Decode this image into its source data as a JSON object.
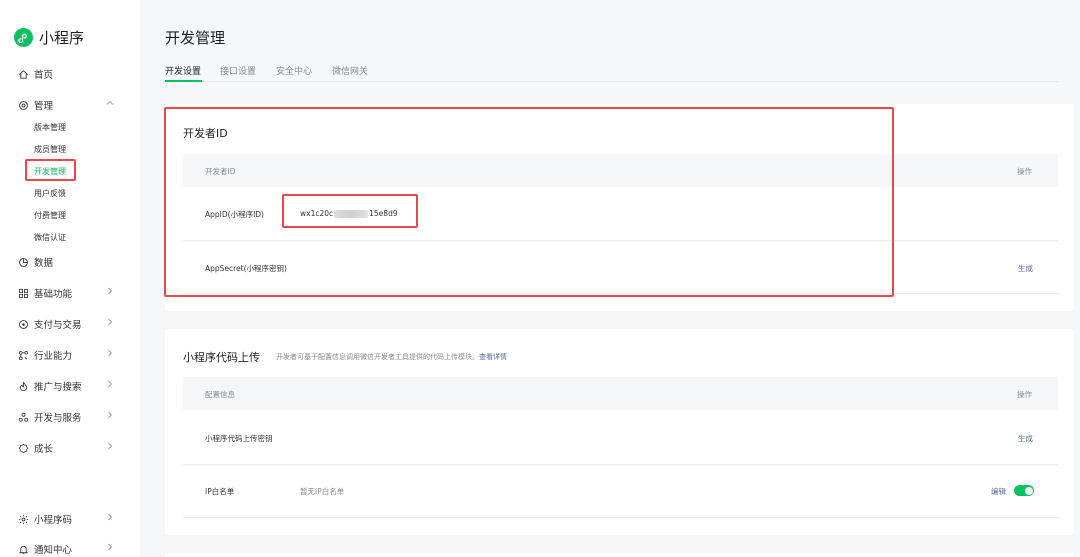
{
  "app": {
    "title": "小程序"
  },
  "sidebar": {
    "home": "首页",
    "manage": "管理",
    "sub_items": [
      "版本管理",
      "成员管理",
      "开发管理",
      "用户反馈",
      "付费管理",
      "微信认证"
    ],
    "data": "数据",
    "groups": [
      "基础功能",
      "支付与交易",
      "行业能力",
      "推广与搜索",
      "开发与服务",
      "成长"
    ],
    "bottom": [
      "小程序码",
      "通知中心"
    ]
  },
  "page": {
    "title": "开发管理",
    "tabs": [
      "开发设置",
      "接口设置",
      "安全中心",
      "微信网关"
    ]
  },
  "developer_id": {
    "title": "开发者ID",
    "header_col1": "开发者ID",
    "header_col2": "操作",
    "appid_label": "AppID(小程序ID)",
    "appid_prefix": "wx1c20c",
    "appid_suffix": "15e8d9",
    "secret_label": "AppSecret(小程序密钥)",
    "secret_action": "生成"
  },
  "upload": {
    "title": "小程序代码上传",
    "desc": "开发者可基于配置信息调用微信开发者工具提供的代码上传模块。",
    "desc_link": "查看详情",
    "header_col1": "配置信息",
    "header_col2": "操作",
    "key_label": "小程序代码上传密钥",
    "key_action": "生成",
    "ip_label": "IP白名单",
    "ip_value": "暂无IP白名单",
    "ip_action": "编辑",
    "ip_toggle_on": true
  },
  "colors": {
    "accent": "#07c160",
    "link": "#576b95",
    "highlight": "#e8484f"
  }
}
